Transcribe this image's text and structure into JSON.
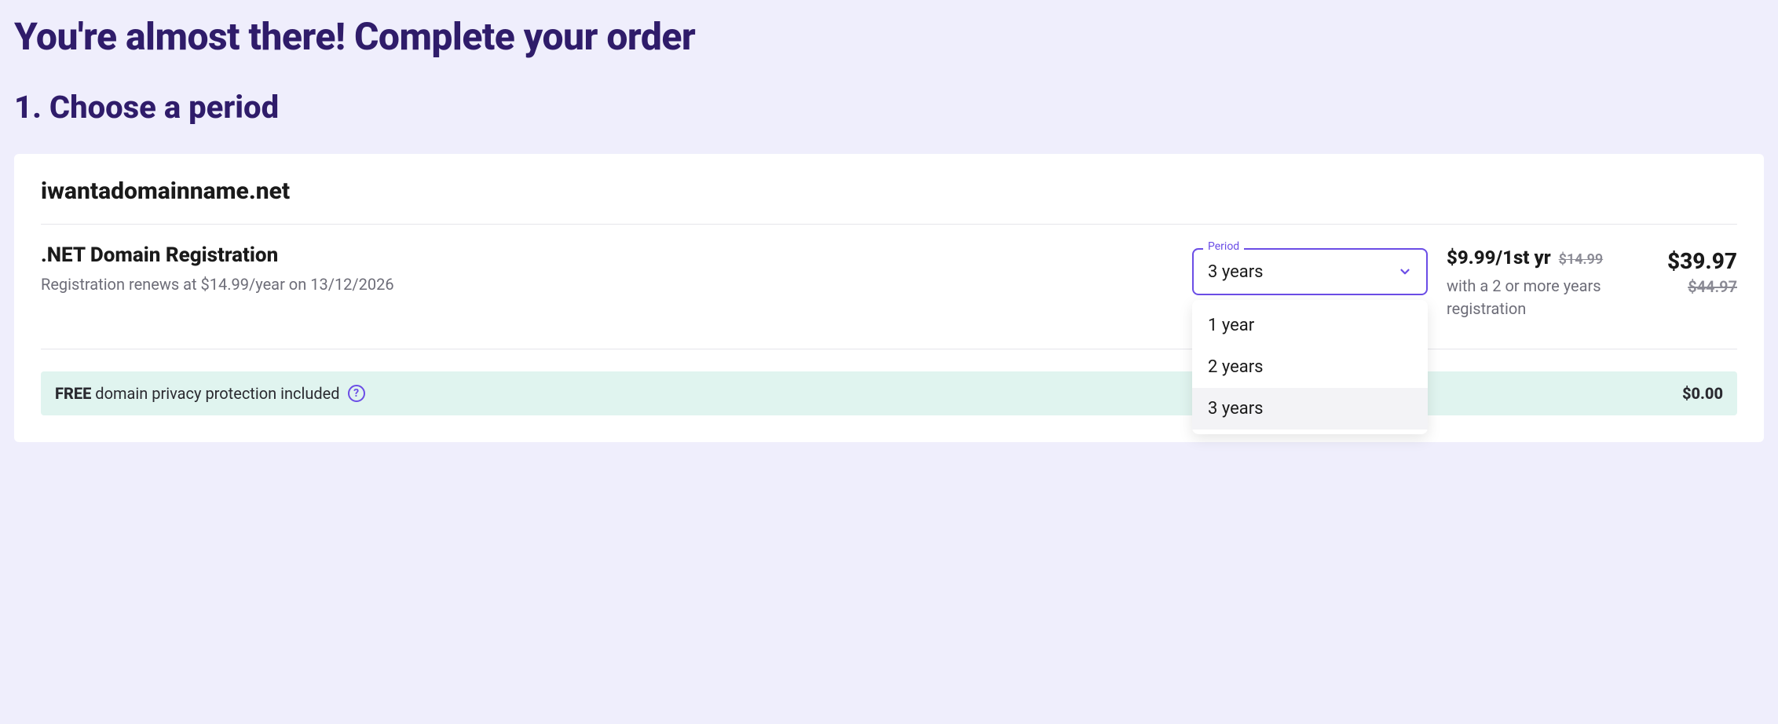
{
  "page_title": "You're almost there! Complete your order",
  "step_title": "1. Choose a period",
  "domain_name": "iwantadomainname.net",
  "registration": {
    "title": ".NET Domain Registration",
    "renewal_note": "Registration renews at $14.99/year on 13/12/2026"
  },
  "period_select": {
    "label": "Period",
    "selected": "3 years",
    "options": [
      "1 year",
      "2 years",
      "3 years"
    ]
  },
  "pricing": {
    "first_year": "$9.99/1st yr",
    "first_year_strike": "$14.99",
    "note": "with a 2 or more years registration",
    "total": "$39.97",
    "total_strike": "$44.97"
  },
  "privacy": {
    "free_label": "FREE",
    "text": "domain privacy protection included",
    "price": "$0.00"
  }
}
